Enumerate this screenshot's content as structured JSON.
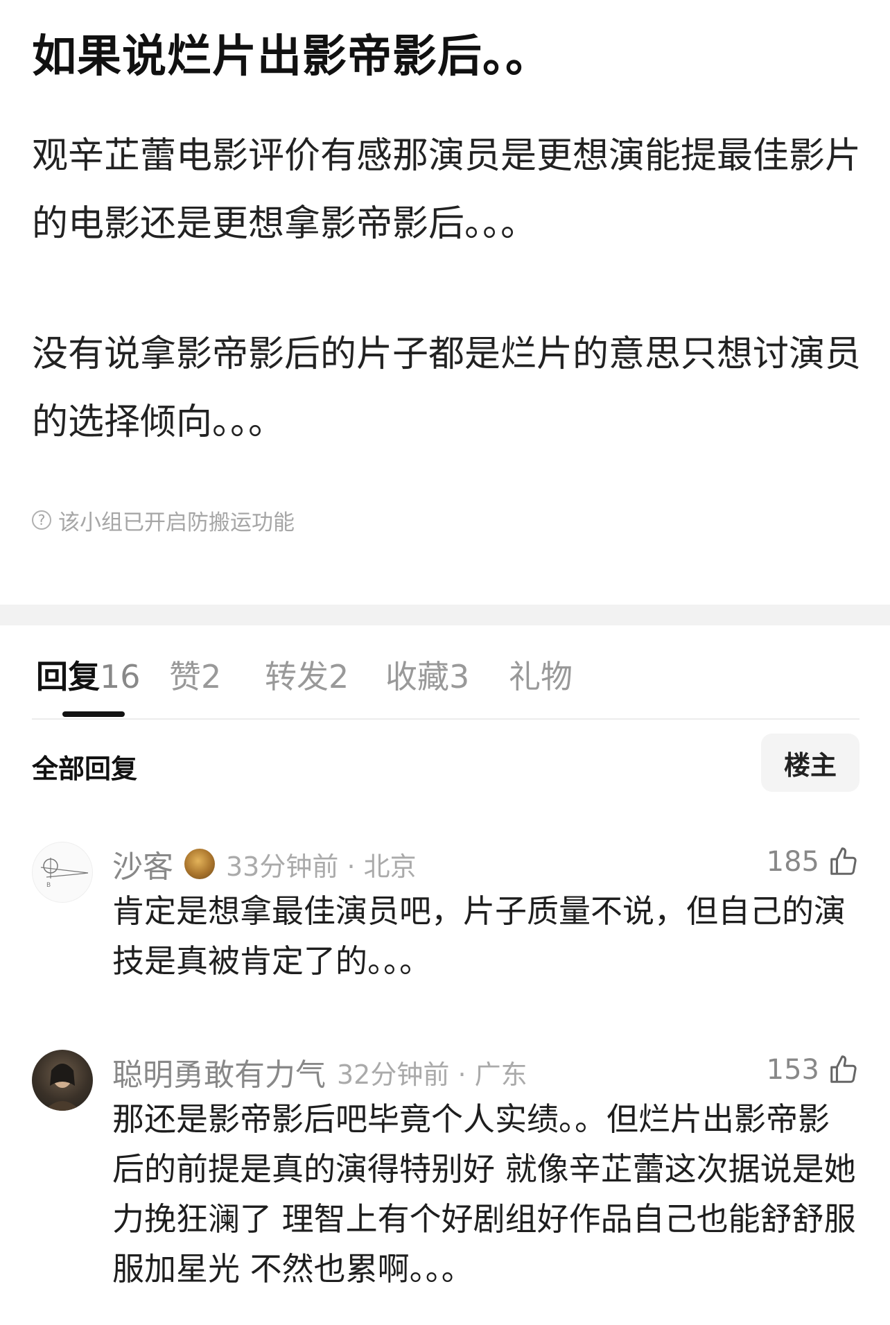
{
  "post": {
    "title": "如果说烂片出影帝影后。。",
    "paragraph1": "观辛芷蕾电影评价有感那演员是更想演能提最佳影片的电影还是更想拿影帝影后。。。",
    "paragraph2": "没有说拿影帝影后的片子都是烂片的意思只想讨演员的选择倾向。。。",
    "notice": "该小组已开启防搬运功能"
  },
  "tabs": [
    {
      "label": "回复",
      "count": "16"
    },
    {
      "label": "赞",
      "count": "2"
    },
    {
      "label": "转发",
      "count": "2"
    },
    {
      "label": "收藏",
      "count": "3"
    },
    {
      "label": "礼物",
      "count": ""
    }
  ],
  "filter": {
    "label": "全部回复",
    "op_button": "楼主"
  },
  "comments": [
    {
      "username": "沙客",
      "time": "33分钟前",
      "location": "北京",
      "likes": "185",
      "text": "肯定是想拿最佳演员吧，片子质量不说，但自己的演技是真被肯定了的。。。"
    },
    {
      "username": "聪明勇敢有力气",
      "time": "32分钟前",
      "location": "广东",
      "likes": "153",
      "text": "那还是影帝影后吧毕竟个人实绩。。但烂片出影帝影后的前提是真的演得特别好 就像辛芷蕾这次据说是她力挽狂澜了 理智上有个好剧组好作品自己也能舒舒服服加星光 不然也累啊。。。"
    }
  ],
  "icons": {
    "notice": "question-circle-icon",
    "like": "thumbs-up-icon",
    "badge": "medal-badge-icon"
  }
}
